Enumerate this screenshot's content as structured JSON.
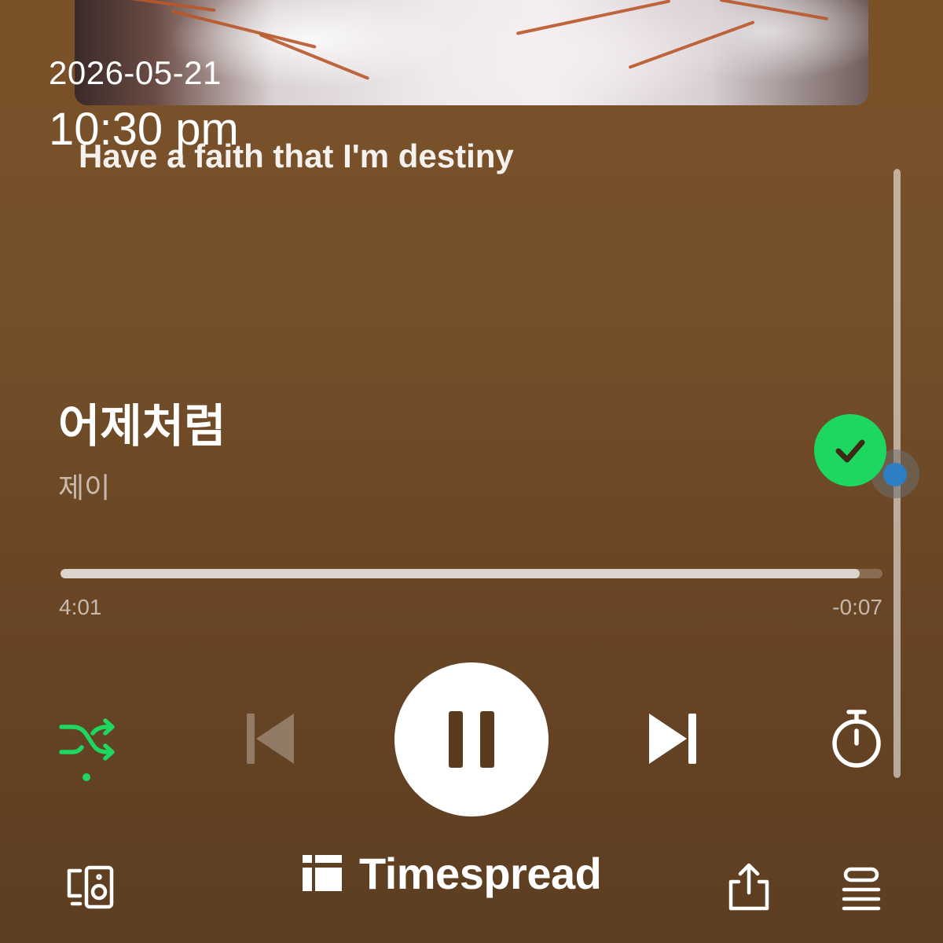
{
  "timestamp": {
    "date": "2026-05-21",
    "time": "10:30 pm"
  },
  "lyric": {
    "current_line": "Have a faith that I'm destiny"
  },
  "track": {
    "title": "어제처럼",
    "artist": "제이",
    "saved": true
  },
  "playback": {
    "elapsed": "4:01",
    "remaining": "-0:07",
    "progress_fraction": 0.972,
    "state": "playing",
    "shuffle_on": true
  },
  "watermark": {
    "text": "Timespread"
  },
  "colors": {
    "accent_green": "#1ed760",
    "background_top": "#7b5128",
    "background_bottom": "#5d3e22",
    "scroll_dot": "#2d7fc4"
  },
  "icons": {
    "saved": "check-circle-icon",
    "shuffle": "shuffle-icon",
    "previous": "skip-previous-icon",
    "play_pause": "pause-icon",
    "next": "skip-next-icon",
    "sleep_timer": "stopwatch-icon",
    "devices": "connect-device-icon",
    "share": "share-icon",
    "queue": "queue-icon"
  }
}
